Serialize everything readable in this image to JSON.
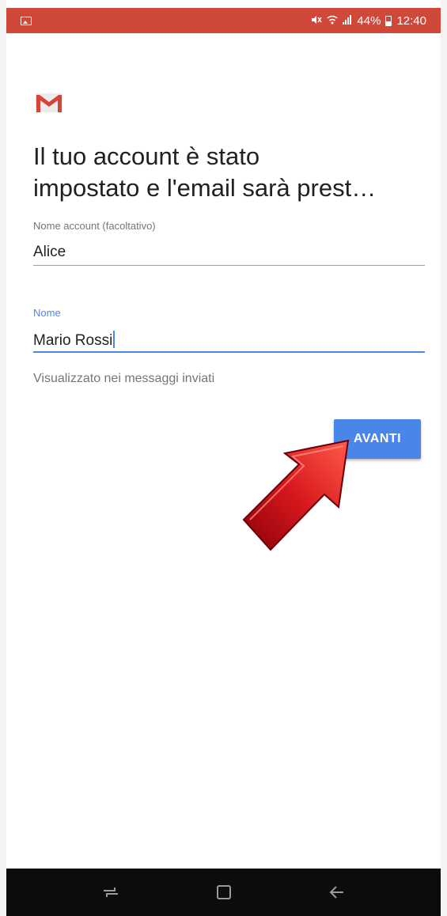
{
  "status_bar": {
    "battery": "44%",
    "time": "12:40",
    "icons": [
      "image-notification-icon",
      "mute-icon",
      "wifi-icon",
      "signal-icon",
      "battery-icon"
    ]
  },
  "header": {
    "logo": "gmail-logo",
    "title_line1": "Il tuo account è stato",
    "title_line2": "impostato e l'email sarà prest…"
  },
  "form": {
    "account_name": {
      "label": "Nome account (facoltativo)",
      "value": "Alice"
    },
    "name": {
      "label": "Nome",
      "value": "Mario Rossi",
      "helper": "Visualizzato nei messaggi inviati"
    },
    "next_label": "AVANTI"
  },
  "nav_bar": {
    "buttons": [
      "recents-icon",
      "home-icon",
      "back-icon"
    ]
  },
  "colors": {
    "status_bar": "#d0483a",
    "accent": "#4a86e8",
    "arrow": "#c8141a",
    "nav_bar": "#0c0c0c"
  }
}
